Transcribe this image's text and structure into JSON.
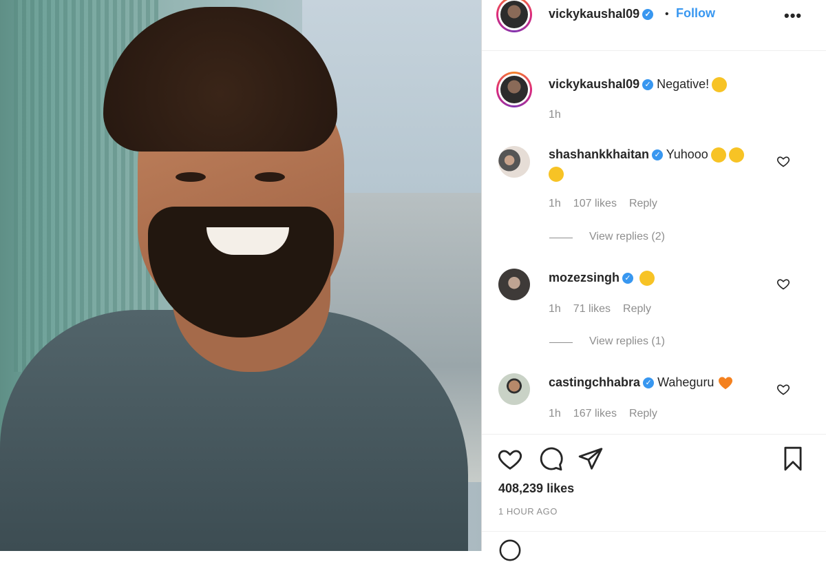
{
  "post": {
    "author": "vickykaushal09",
    "follow_label": "Follow",
    "separator": "•",
    "more_label": "•••",
    "caption": "Negative!",
    "caption_time": "1h",
    "likes": "408,239 likes",
    "posted_ago": "1 HOUR AGO"
  },
  "comments": [
    {
      "user": "shashankkhaitan",
      "text": "Yuhooo",
      "time": "1h",
      "likes": "107 likes",
      "reply": "Reply",
      "view_replies": "View replies (2)"
    },
    {
      "user": "mozezsingh",
      "text": "",
      "time": "1h",
      "likes": "71 likes",
      "reply": "Reply",
      "view_replies": "View replies (1)"
    },
    {
      "user": "castingchhabra",
      "text": "Waheguru",
      "time": "1h",
      "likes": "167 likes",
      "reply": "Reply"
    }
  ],
  "icons": {
    "like": "heart-icon",
    "comment": "comment-bubble-icon",
    "share": "paper-plane-icon",
    "save": "bookmark-icon",
    "verified": "verified-badge-icon"
  },
  "colors": {
    "accent": "#3897f0",
    "muted": "#8e8e8e",
    "text": "#262626"
  }
}
